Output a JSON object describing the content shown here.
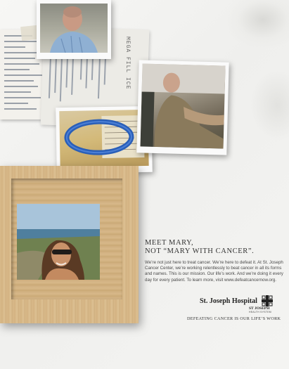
{
  "ad": {
    "headline_line1": "MEET MARY,",
    "headline_line2": "NOT “MARY WITH CANCER”.",
    "body": "We’re not just here to treat cancer. We’re here to defeat it. At St. Joseph Cancer Center, we’re working relentlessly to beat cancer in all its forms and names. This is our mission. Our life’s work. And we’re doing it every day for every patient. To learn more, visit www.defeatcancernow.org.",
    "tagline": "DEFEATING CANCER IS OUR LIFE’S WORK"
  },
  "logo": {
    "name": "St. Joseph Hospital",
    "sub_name": "ST JOSEPH",
    "sub_caption": "HEALTH SYSTEM"
  },
  "collage": {
    "wristband_text": "MEGA FILL ICE"
  },
  "colors": {
    "background": "#f4f4f2",
    "wood": "#d8b98a",
    "text": "#333333",
    "wristband": "#2a5fb8"
  }
}
